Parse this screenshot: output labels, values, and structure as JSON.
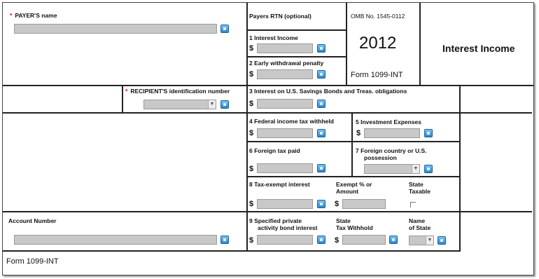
{
  "header": {
    "payer_name_label": "PAYER'S name",
    "required_mark": "*",
    "payers_rtn_label": "Payers RTN (optional)",
    "omb_label": "OMB No. 1545-0112",
    "year": "2012",
    "form_label": "Form 1099-INT",
    "title": "Interest Income"
  },
  "boxes": {
    "box1_label": "1 Interest Income",
    "box2_label": "2 Early withdrawal penalty",
    "recipient_id_label": "RECIPIENT'S identification number",
    "box3_label": "3 Interest on U.S. Savings Bonds and Treas. obligations",
    "box4_label": "4 Federal income tax withheld",
    "box5_label": "5 Investment Expenses",
    "box6_label": "6 Foreign tax paid",
    "box7_label_line1": "7 Foreign country or U.S.",
    "box7_label_line2": "possession",
    "box8_label": "8 Tax-exempt interest",
    "exempt_label_line1": "Exempt % or",
    "exempt_label_line2": "Amount",
    "state_taxable_line1": "State",
    "state_taxable_line2": "Taxable",
    "account_number_label": "Account Number",
    "box9_label_line1": "9 Specified private",
    "box9_label_line2": "activity bond interest",
    "state_withhold_line1": "State",
    "state_withhold_line2": "Tax Withhold",
    "name_state_line1": "Name",
    "name_state_line2": "of State"
  },
  "currency_symbol": "$",
  "footer": {
    "form_name": "Form 1099-INT"
  },
  "colors": {
    "field_bg": "#c8c8c8",
    "button": "#2f86c9",
    "required": "#e00000"
  }
}
